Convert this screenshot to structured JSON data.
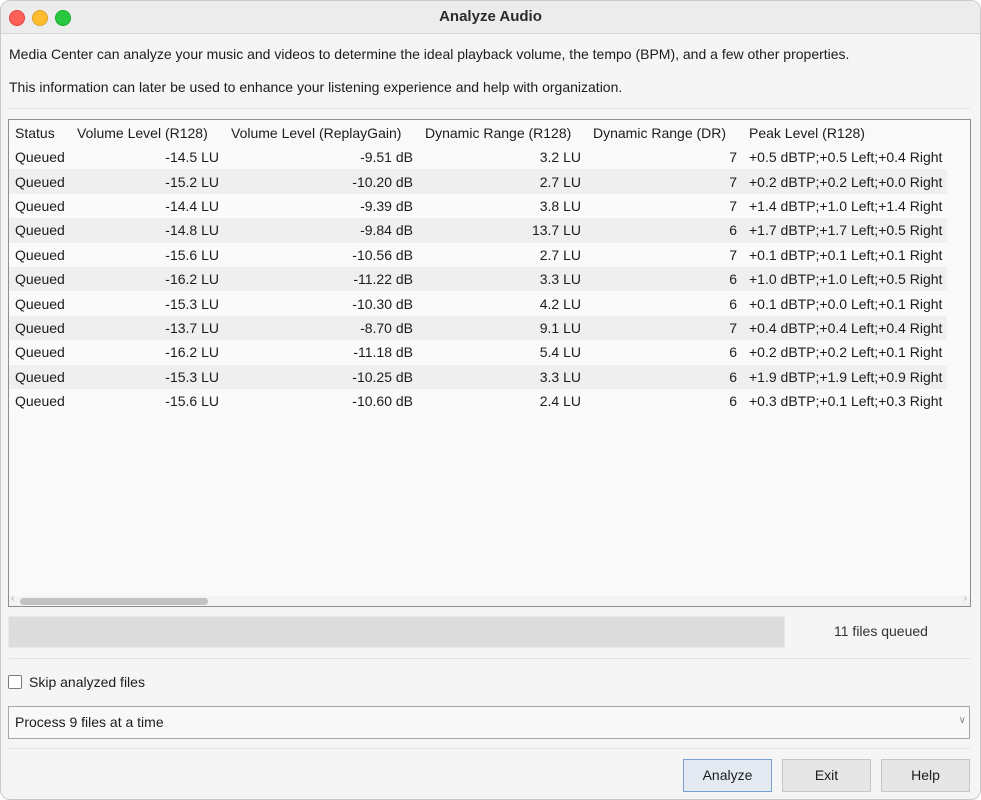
{
  "window": {
    "title": "Analyze Audio"
  },
  "description": {
    "line1": "Media Center can analyze your music and videos to determine the ideal playback volume, the tempo (BPM), and a few other properties.",
    "line2": "This information can later be used to enhance your listening experience and help with organization."
  },
  "table": {
    "columns": [
      "Status",
      "Volume Level (R128)",
      "Volume Level (ReplayGain)",
      "Dynamic Range (R128)",
      "Dynamic Range (DR)",
      "Peak Level (R128)"
    ],
    "rows": [
      [
        "Queued",
        "-14.5 LU",
        "-9.51 dB",
        "3.2 LU",
        "7",
        "+0.5 dBTP;+0.5 Left;+0.4 Right"
      ],
      [
        "Queued",
        "-15.2 LU",
        "-10.20 dB",
        "2.7 LU",
        "7",
        "+0.2 dBTP;+0.2 Left;+0.0 Right"
      ],
      [
        "Queued",
        "-14.4 LU",
        "-9.39 dB",
        "3.8 LU",
        "7",
        "+1.4 dBTP;+1.0 Left;+1.4 Right"
      ],
      [
        "Queued",
        "-14.8 LU",
        "-9.84 dB",
        "13.7 LU",
        "6",
        "+1.7 dBTP;+1.7 Left;+0.5 Right"
      ],
      [
        "Queued",
        "-15.6 LU",
        "-10.56 dB",
        "2.7 LU",
        "7",
        "+0.1 dBTP;+0.1 Left;+0.1 Right"
      ],
      [
        "Queued",
        "-16.2 LU",
        "-11.22 dB",
        "3.3 LU",
        "6",
        "+1.0 dBTP;+1.0 Left;+0.5 Right"
      ],
      [
        "Queued",
        "-15.3 LU",
        "-10.30 dB",
        "4.2 LU",
        "6",
        "+0.1 dBTP;+0.0 Left;+0.1 Right"
      ],
      [
        "Queued",
        "-13.7 LU",
        "-8.70 dB",
        "9.1 LU",
        "7",
        "+0.4 dBTP;+0.4 Left;+0.4 Right"
      ],
      [
        "Queued",
        "-16.2 LU",
        "-11.18 dB",
        "5.4 LU",
        "6",
        "+0.2 dBTP;+0.2 Left;+0.1 Right"
      ],
      [
        "Queued",
        "-15.3 LU",
        "-10.25 dB",
        "3.3 LU",
        "6",
        "+1.9 dBTP;+1.9 Left;+0.9 Right"
      ],
      [
        "Queued",
        "-15.6 LU",
        "-10.60 dB",
        "2.4 LU",
        "6",
        "+0.3 dBTP;+0.1 Left;+0.3 Right"
      ]
    ]
  },
  "progress": {
    "status_text": "11 files queued"
  },
  "options": {
    "skip_analyzed_label": "Skip analyzed files",
    "skip_analyzed_checked": false,
    "concurrency_value": "Process 9 files at a time"
  },
  "buttons": {
    "analyze": "Analyze",
    "exit": "Exit",
    "help": "Help"
  }
}
